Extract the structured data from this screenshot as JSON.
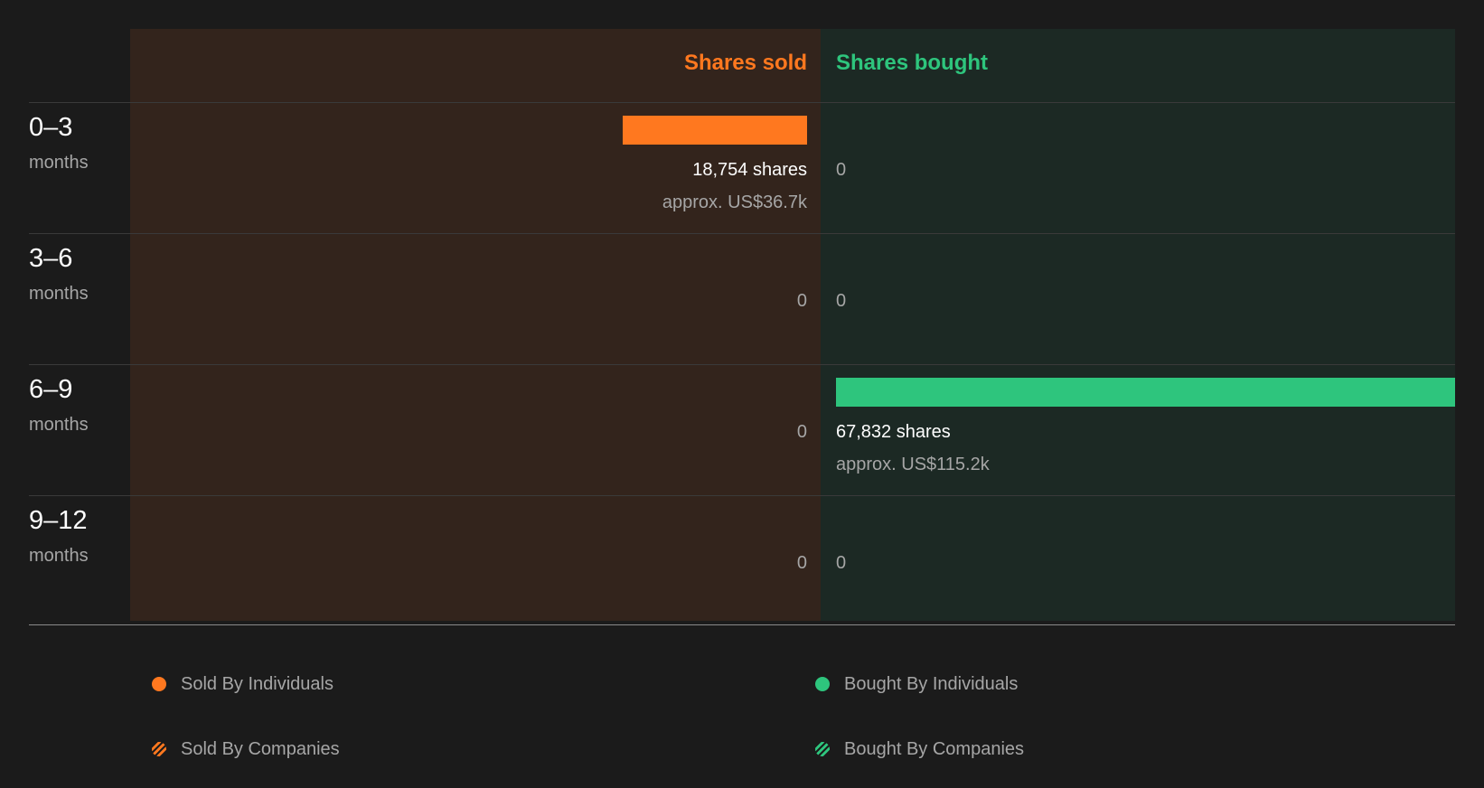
{
  "colors": {
    "sold": "#ff781f",
    "bought": "#2ec57d",
    "sold_panel": "#33241c",
    "bought_panel": "#1c2924"
  },
  "headers": {
    "sold": "Shares sold",
    "bought": "Shares bought"
  },
  "chart_data": {
    "type": "bar",
    "orientation": "horizontal-diverging",
    "categories": [
      {
        "range": "0–3",
        "unit": "months"
      },
      {
        "range": "3–6",
        "unit": "months"
      },
      {
        "range": "6–9",
        "unit": "months"
      },
      {
        "range": "9–12",
        "unit": "months"
      }
    ],
    "series": [
      {
        "name": "Shares sold",
        "values": [
          18754,
          0,
          0,
          0
        ],
        "labels": [
          "18,754 shares",
          "0",
          "0",
          "0"
        ],
        "approx": [
          "approx. US$36.7k",
          "",
          "",
          ""
        ]
      },
      {
        "name": "Shares bought",
        "values": [
          0,
          0,
          67832,
          0
        ],
        "labels": [
          "0",
          "0",
          "67,832 shares",
          "0"
        ],
        "approx": [
          "",
          "",
          "approx. US$115.2k",
          ""
        ]
      }
    ],
    "max_value": 67832
  },
  "legend": [
    {
      "label": "Sold By Individuals",
      "color": "#ff781f",
      "pattern": "solid"
    },
    {
      "label": "Bought By Individuals",
      "color": "#2ec57d",
      "pattern": "solid"
    },
    {
      "label": "Sold By Companies",
      "color": "#ff781f",
      "pattern": "striped"
    },
    {
      "label": "Bought By Companies",
      "color": "#2ec57d",
      "pattern": "striped"
    }
  ]
}
